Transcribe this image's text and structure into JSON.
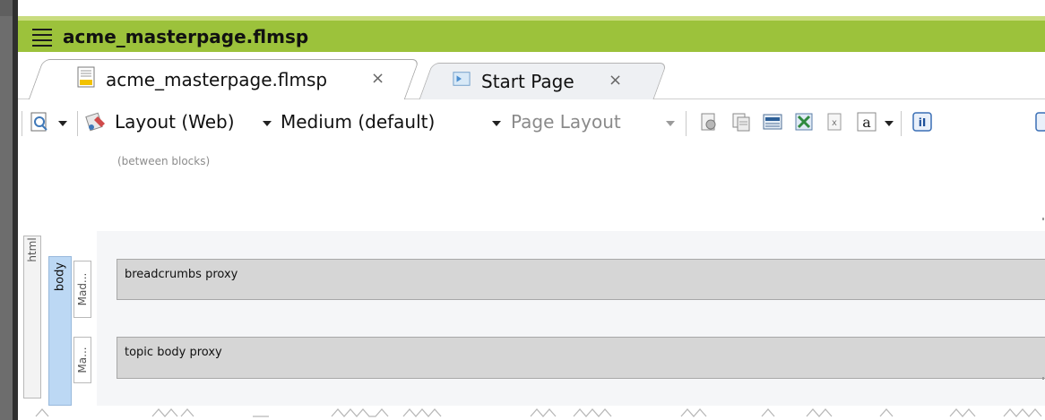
{
  "window": {
    "title": "acme_masterpage.flmsp"
  },
  "tabs": [
    {
      "label": "acme_masterpage.flmsp",
      "close": "×",
      "active": true,
      "icon": "document-icon"
    },
    {
      "label": "Start Page",
      "close": "×",
      "active": false,
      "icon": "start-page-icon"
    }
  ],
  "toolbar": {
    "medium_type": "Layout (Web)",
    "medium": "Medium (default)",
    "view": "Page Layout",
    "text_style_btn": "a",
    "info_btn": "iI"
  },
  "canvas": {
    "hint": "(between blocks)",
    "structure": {
      "html": "html",
      "body": "body",
      "mad1": "Mad...",
      "mad2": "Ma..."
    },
    "blocks": [
      {
        "label": "breadcrumbs proxy"
      },
      {
        "label": "topic body proxy"
      }
    ]
  },
  "colors": {
    "titlebar": "#9cc23b",
    "body_bar": "#bcd8f4",
    "proxy": "#d6d6d6"
  }
}
